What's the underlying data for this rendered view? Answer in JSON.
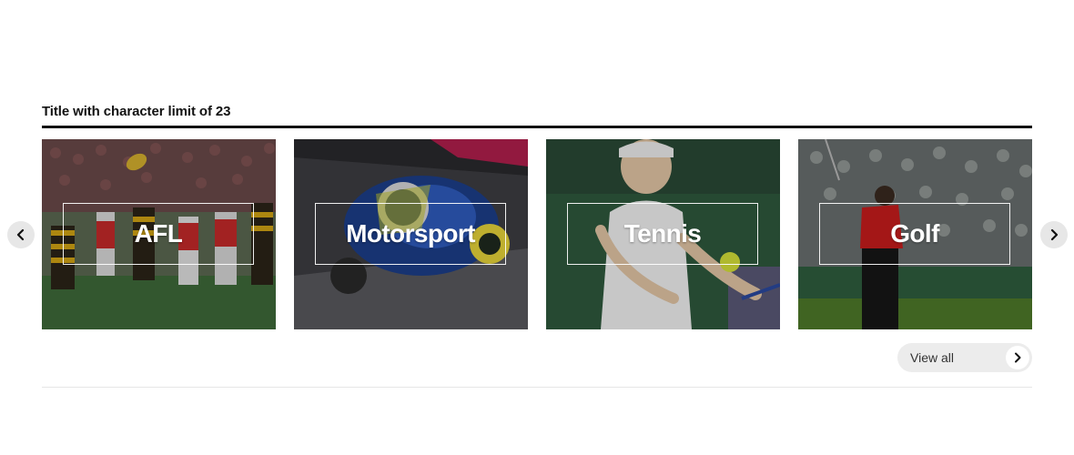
{
  "section": {
    "title": "Title with character limit of 23"
  },
  "carousel": {
    "prev_icon": "chevron-left-icon",
    "next_icon": "chevron-right-icon",
    "tiles": [
      {
        "label": "AFL"
      },
      {
        "label": "Motorsport"
      },
      {
        "label": "Tennis"
      },
      {
        "label": "Golf"
      }
    ]
  },
  "view_all": {
    "label": "View all",
    "icon": "chevron-right-icon"
  },
  "colors": {
    "title_rule": "#121212",
    "arrow_bg": "#e7e7e7",
    "view_all_bg": "#ececec"
  }
}
